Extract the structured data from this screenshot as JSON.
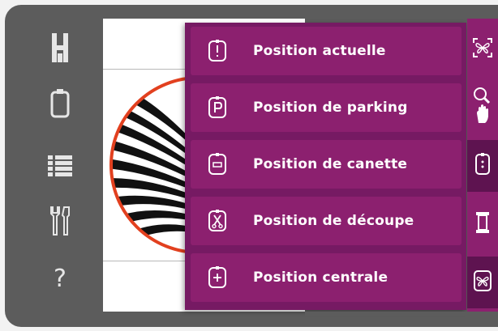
{
  "sidebar": {
    "items": [
      {
        "icon": "presser-foot-icon"
      },
      {
        "icon": "hoop-icon"
      },
      {
        "icon": "stitch-list-icon"
      },
      {
        "icon": "tools-icon"
      },
      {
        "icon": "help-icon",
        "label": "?"
      }
    ]
  },
  "menu": {
    "items": [
      {
        "icon": "current-position-icon",
        "label": "Position actuelle"
      },
      {
        "icon": "parking-position-icon",
        "label": "Position de parking"
      },
      {
        "icon": "bobbin-position-icon",
        "label": "Position de canette"
      },
      {
        "icon": "cut-position-icon",
        "label": "Position de découpe"
      },
      {
        "icon": "center-position-icon",
        "label": "Position centrale"
      }
    ]
  },
  "rightbar": {
    "items": [
      {
        "icon": "butterfly-frame-icon"
      },
      {
        "icon": "zoom-pan-icon"
      },
      {
        "icon": "hoop-positions-icon",
        "active": true
      },
      {
        "icon": "thread-spool-icon"
      },
      {
        "icon": "butterfly-stitch-icon",
        "active": true
      }
    ]
  },
  "colors": {
    "frame": "#5c5c5c",
    "menu_bg": "#761a63",
    "menu_item": "#8c206f",
    "active_dark": "#5e1350",
    "hoop_outline": "#e2401f"
  }
}
